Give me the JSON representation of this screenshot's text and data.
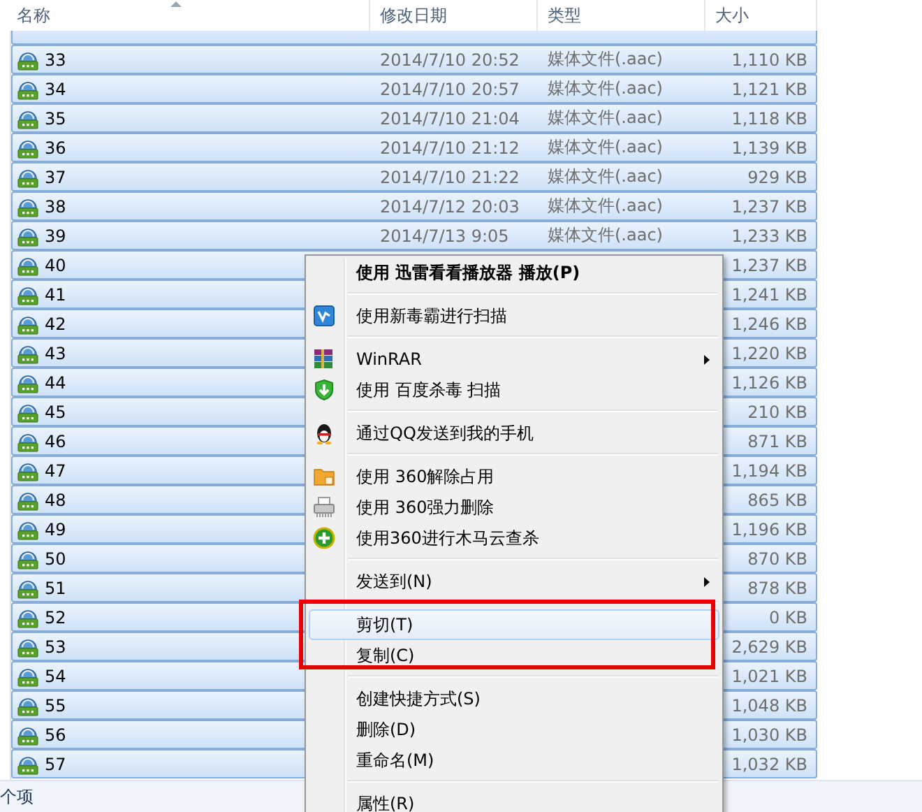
{
  "columns": [
    {
      "label": "名称",
      "sorted": true
    },
    {
      "label": "修改日期",
      "sorted": false
    },
    {
      "label": "类型",
      "sorted": false
    },
    {
      "label": "大小",
      "sorted": false
    }
  ],
  "files": [
    {
      "selected": true
    },
    {
      "name": "33",
      "modified": "2014/7/10 20:52",
      "type": "媒体文件(.aac)",
      "size": "1,110 KB",
      "selected": true
    },
    {
      "name": "34",
      "modified": "2014/7/10 20:57",
      "type": "媒体文件(.aac)",
      "size": "1,121 KB",
      "selected": true
    },
    {
      "name": "35",
      "modified": "2014/7/10 21:04",
      "type": "媒体文件(.aac)",
      "size": "1,118 KB",
      "selected": true
    },
    {
      "name": "36",
      "modified": "2014/7/10 21:12",
      "type": "媒体文件(.aac)",
      "size": "1,139 KB",
      "selected": true
    },
    {
      "name": "37",
      "modified": "2014/7/10 21:22",
      "type": "媒体文件(.aac)",
      "size": "929 KB",
      "selected": true
    },
    {
      "name": "38",
      "modified": "2014/7/12 20:03",
      "type": "媒体文件(.aac)",
      "size": "1,237 KB",
      "selected": true
    },
    {
      "name": "39",
      "modified": "2014/7/13 9:05",
      "type": "媒体文件(.aac)",
      "size": "1,233 KB",
      "selected": true
    },
    {
      "name": "40",
      "size": "1,237 KB",
      "selected": true
    },
    {
      "name": "41",
      "size": "1,241 KB",
      "selected": true
    },
    {
      "name": "42",
      "size": "1,246 KB",
      "selected": true
    },
    {
      "name": "43",
      "size": "1,220 KB",
      "selected": true
    },
    {
      "name": "44",
      "size": "1,126 KB",
      "selected": true
    },
    {
      "name": "45",
      "size": "210 KB",
      "selected": true
    },
    {
      "name": "46",
      "size": "871 KB",
      "selected": true
    },
    {
      "name": "47",
      "size": "1,194 KB",
      "selected": true
    },
    {
      "name": "48",
      "size": "865 KB",
      "selected": true
    },
    {
      "name": "49",
      "size": "1,196 KB",
      "selected": true
    },
    {
      "name": "50",
      "size": "870 KB",
      "selected": true
    },
    {
      "name": "51",
      "size": "878 KB",
      "selected": true
    },
    {
      "name": "52",
      "size": "0 KB",
      "selected": true
    },
    {
      "name": "53",
      "size": "2,629 KB",
      "selected": true
    },
    {
      "name": "54",
      "size": "1,021 KB",
      "selected": true
    },
    {
      "name": "55",
      "size": "1,048 KB",
      "selected": true
    },
    {
      "name": "56",
      "size": "1,030 KB",
      "selected": true
    },
    {
      "name": "57",
      "size": "1,032 KB",
      "selected": true
    }
  ],
  "context_menu": {
    "items": [
      {
        "kind": "item",
        "label": "使用 迅雷看看播放器 播放(P)",
        "default": true,
        "highlighted": false,
        "submenu": false
      },
      {
        "kind": "separator"
      },
      {
        "kind": "item",
        "label": "使用新毒霸进行扫描",
        "default": false,
        "highlighted": false,
        "submenu": false
      },
      {
        "kind": "separator"
      },
      {
        "kind": "item",
        "label": "WinRAR",
        "default": false,
        "highlighted": false,
        "submenu": true
      },
      {
        "kind": "item",
        "label": "使用 百度杀毒 扫描",
        "default": false,
        "highlighted": false,
        "submenu": false
      },
      {
        "kind": "separator"
      },
      {
        "kind": "item",
        "label": "通过QQ发送到我的手机",
        "default": false,
        "highlighted": false,
        "submenu": false
      },
      {
        "kind": "separator"
      },
      {
        "kind": "item",
        "label": "使用 360解除占用",
        "default": false,
        "highlighted": false,
        "submenu": false
      },
      {
        "kind": "item",
        "label": "使用 360强力删除",
        "default": false,
        "highlighted": false,
        "submenu": false
      },
      {
        "kind": "item",
        "label": "使用360进行木马云查杀",
        "default": false,
        "highlighted": false,
        "submenu": false
      },
      {
        "kind": "separator"
      },
      {
        "kind": "item",
        "label": "发送到(N)",
        "default": false,
        "highlighted": false,
        "submenu": true
      },
      {
        "kind": "separator"
      },
      {
        "kind": "item",
        "label": "剪切(T)",
        "default": false,
        "highlighted": true,
        "submenu": false
      },
      {
        "kind": "item",
        "label": "复制(C)",
        "default": false,
        "highlighted": false,
        "submenu": false
      },
      {
        "kind": "separator"
      },
      {
        "kind": "item",
        "label": "创建快捷方式(S)",
        "default": false,
        "highlighted": false,
        "submenu": false
      },
      {
        "kind": "item",
        "label": "删除(D)",
        "default": false,
        "highlighted": false,
        "submenu": false
      },
      {
        "kind": "item",
        "label": "重命名(M)",
        "default": false,
        "highlighted": false,
        "submenu": false
      },
      {
        "kind": "separator"
      },
      {
        "kind": "item",
        "label": "属性(R)",
        "default": false,
        "highlighted": false,
        "submenu": false
      }
    ]
  },
  "status_bar": {
    "text": "个项"
  }
}
